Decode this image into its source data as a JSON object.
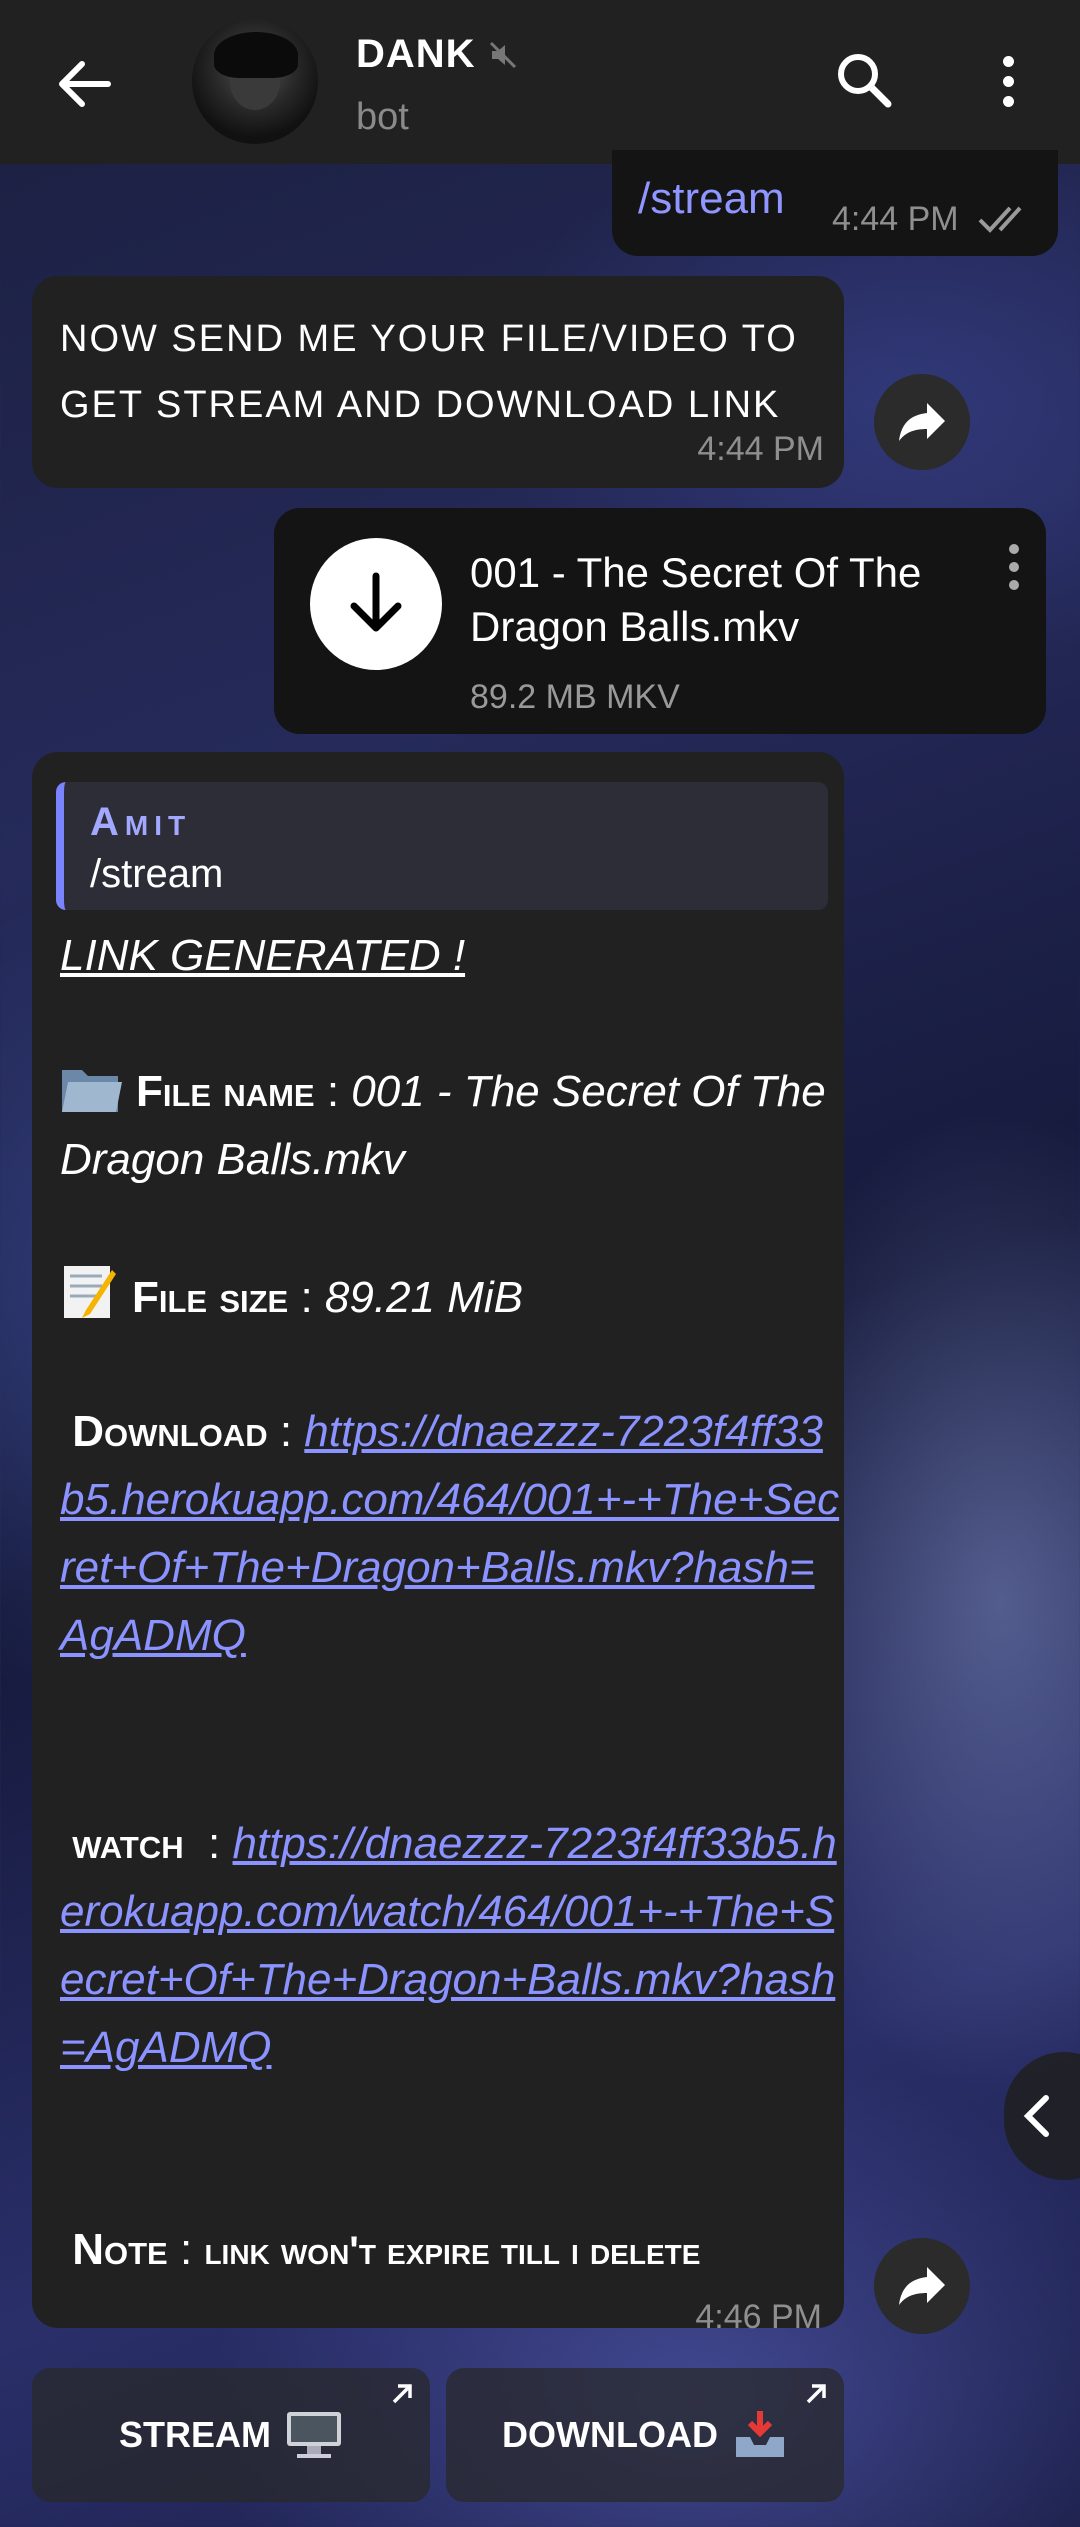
{
  "header": {
    "title": "DANK",
    "subtitle": "bot"
  },
  "messages": {
    "cmd": {
      "text": "/stream",
      "time": "4:44 PM"
    },
    "prompt": {
      "text": "NOW SEND ME YOUR FILE/VIDEO TO GET STREAM AND DOWNLOAD LINK",
      "time": "4:44 PM"
    },
    "file": {
      "name": "001 - The Secret Of The Dragon Balls.mkv",
      "size": "89.2 MB MKV"
    },
    "result": {
      "reply_author": "Amit",
      "reply_text": "/stream",
      "heading": "LINK GENERATED !",
      "file_name_label": "File name",
      "file_name_value": "001 - The Secret Of The Dragon Balls.mkv",
      "file_size_label": "File size",
      "file_size_value": "89.21 MiB",
      "download_label": "Download",
      "download_link": "https://dnaezzz-7223f4ff33b5.herokuapp.com/464/001+-+The+Secret+Of+The+Dragon+Balls.mkv?hash=AgADMQ",
      "watch_label": "watch",
      "watch_link": "https://dnaezzz-7223f4ff33b5.herokuapp.com/watch/464/001+-+The+Secret+Of+The+Dragon+Balls.mkv?hash=AgADMQ",
      "note_label": "Note",
      "note_text": "link won't expire till i delete",
      "time": "4:46 PM"
    }
  },
  "buttons": {
    "stream": "STREAM",
    "download": "DOWNLOAD"
  },
  "icons": {
    "back": "back-arrow-icon",
    "mute": "muted-speaker-icon",
    "search": "search-icon",
    "menu": "more-vertical-icon",
    "forward": "forward-icon",
    "download": "download-arrow-icon",
    "folder": "folder-icon",
    "memo": "memo-icon",
    "desktop": "desktop-computer-icon",
    "inbox": "inbox-tray-icon"
  }
}
